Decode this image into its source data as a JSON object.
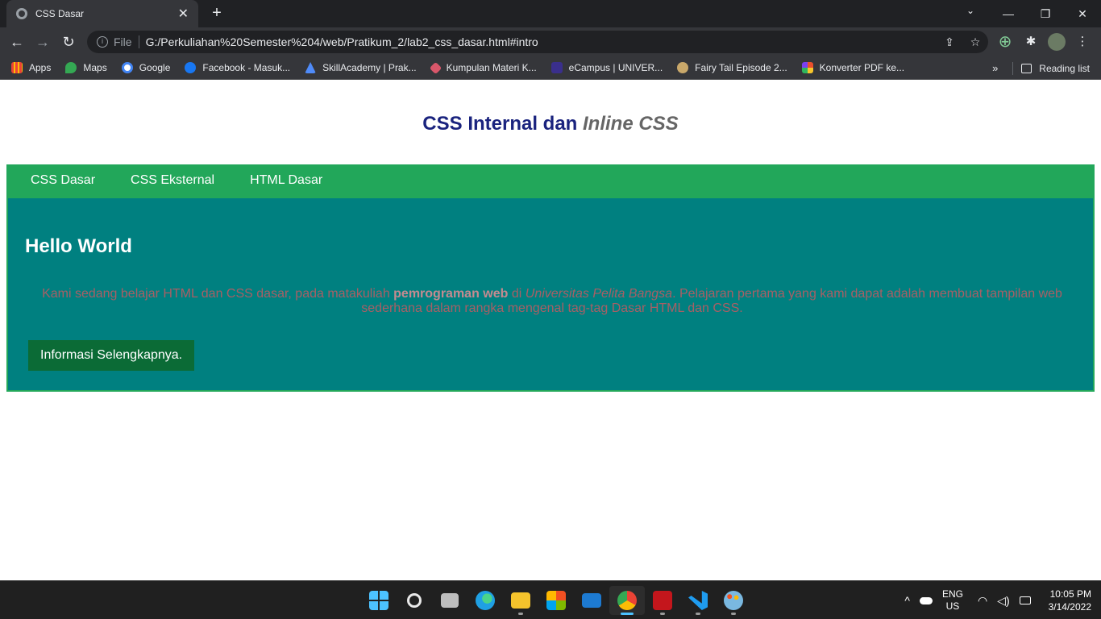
{
  "browser": {
    "tab_title": "CSS Dasar",
    "tab_close": "✕",
    "new_tab": "+",
    "window_controls": {
      "minimize": "—",
      "restore": "❐",
      "close": "✕"
    },
    "tab_search": "⌄",
    "nav": {
      "back": "←",
      "forward": "→",
      "reload": "↻"
    },
    "omnibox": {
      "scheme_label": "File",
      "url": "G:/Perkuliahan%20Semester%204/web/Pratikum_2/lab2_css_dasar.html#intro",
      "share_icon": "⇪",
      "bookmark_icon": "☆"
    },
    "toolbar_right": {
      "extension_add": "⊕",
      "extensions": "✱",
      "menu": "⋮"
    },
    "bookmarks": [
      {
        "label": "Apps",
        "color": "#e8eaed"
      },
      {
        "label": "Maps",
        "color": "#34a853"
      },
      {
        "label": "Google",
        "color": "#ffffff"
      },
      {
        "label": "Facebook - Masuk...",
        "color": "#1877f2"
      },
      {
        "label": "SkillAcademy | Prak...",
        "color": "#4f8bf9"
      },
      {
        "label": "Kumpulan Materi K...",
        "color": "#d9576a"
      },
      {
        "label": "eCampus | UNIVER...",
        "color": "#3a2f8c"
      },
      {
        "label": "Fairy Tail Episode 2...",
        "color": "#c9a86a"
      },
      {
        "label": "Konverter PDF ke...",
        "color": "#e94f2c"
      }
    ],
    "bookmarks_more": "»",
    "reading_list": "Reading list"
  },
  "page": {
    "title_main": "CSS Internal dan ",
    "title_italic": "Inline CSS",
    "nav_links": [
      "CSS Dasar",
      "CSS Eksternal",
      "HTML Dasar"
    ],
    "hero": {
      "heading": "Hello World",
      "text_1": "Kami sedang belajar HTML dan CSS dasar, pada matakuliah ",
      "text_bold": "pemrograman web",
      "text_2": " di ",
      "text_italic": "Universitas Pelita Bangsa",
      "text_3": ". Pelajaran pertama yang kami dapat adalah membuat tampilan web sederhana dalam rangka mengenal tag-tag Dasar HTML dan CSS.",
      "button_label": "Informasi Selengkapnya."
    }
  },
  "taskbar": {
    "apps": [
      {
        "name": "start",
        "color": "#4cc2ff"
      },
      {
        "name": "search",
        "color": "#e8e8e8"
      },
      {
        "name": "task-view",
        "color": "#bdbdbd"
      },
      {
        "name": "edge",
        "color": "#1fa0e3"
      },
      {
        "name": "file-explorer",
        "color": "#f5c32c"
      },
      {
        "name": "store",
        "color": "#5aa0f2"
      },
      {
        "name": "mail",
        "color": "#1d7ad1"
      },
      {
        "name": "chrome",
        "color": "#ea4335"
      },
      {
        "name": "acrobat",
        "color": "#c4161c"
      },
      {
        "name": "vscode",
        "color": "#1f9cf0"
      },
      {
        "name": "paint",
        "color": "#7ab8e0"
      }
    ],
    "tray": {
      "chevron": "^",
      "lang_1": "ENG",
      "lang_2": "US",
      "time": "10:05 PM",
      "date": "3/14/2022"
    }
  }
}
